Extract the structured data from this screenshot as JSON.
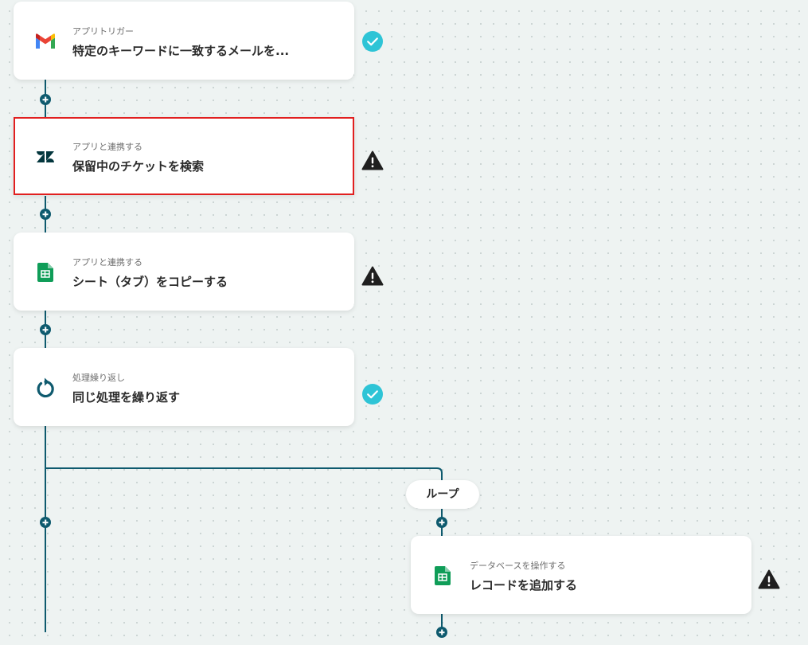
{
  "flow": {
    "steps": [
      {
        "label": "アプリトリガー",
        "title": "特定のキーワードに一致するメールを...",
        "icon": "gmail-icon",
        "status": "complete"
      },
      {
        "label": "アプリと連携する",
        "title": "保留中のチケットを検索",
        "icon": "zendesk-icon",
        "status": "warning",
        "selected": true
      },
      {
        "label": "アプリと連携する",
        "title": "シート（タブ）をコピーする",
        "icon": "google-sheets-icon",
        "status": "warning"
      },
      {
        "label": "処理繰り返し",
        "title": "同じ処理を繰り返す",
        "icon": "loop-icon",
        "status": "complete"
      }
    ],
    "loop": {
      "label": "ループ",
      "steps": [
        {
          "label": "データベースを操作する",
          "title": "レコードを追加する",
          "icon": "google-sheets-icon",
          "status": "warning"
        }
      ]
    }
  },
  "colors": {
    "connector": "#0e5a6e",
    "complete": "#2ec4d6",
    "warning": "#1f1f1f",
    "selected_border": "#e11f1f",
    "canvas_background": "#eef3f2"
  }
}
